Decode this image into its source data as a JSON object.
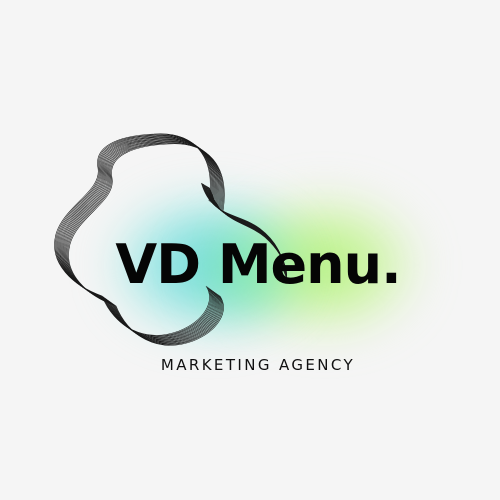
{
  "logo": {
    "brand_name": "VD Menu.",
    "tagline": "MARKETING AGENCY",
    "icon": "abstract-wave-lines-icon"
  },
  "colors": {
    "background": "#f5f5f5",
    "text": "#050505",
    "glow_cyan": "#60d6e2",
    "glow_green": "#aaf06e"
  }
}
